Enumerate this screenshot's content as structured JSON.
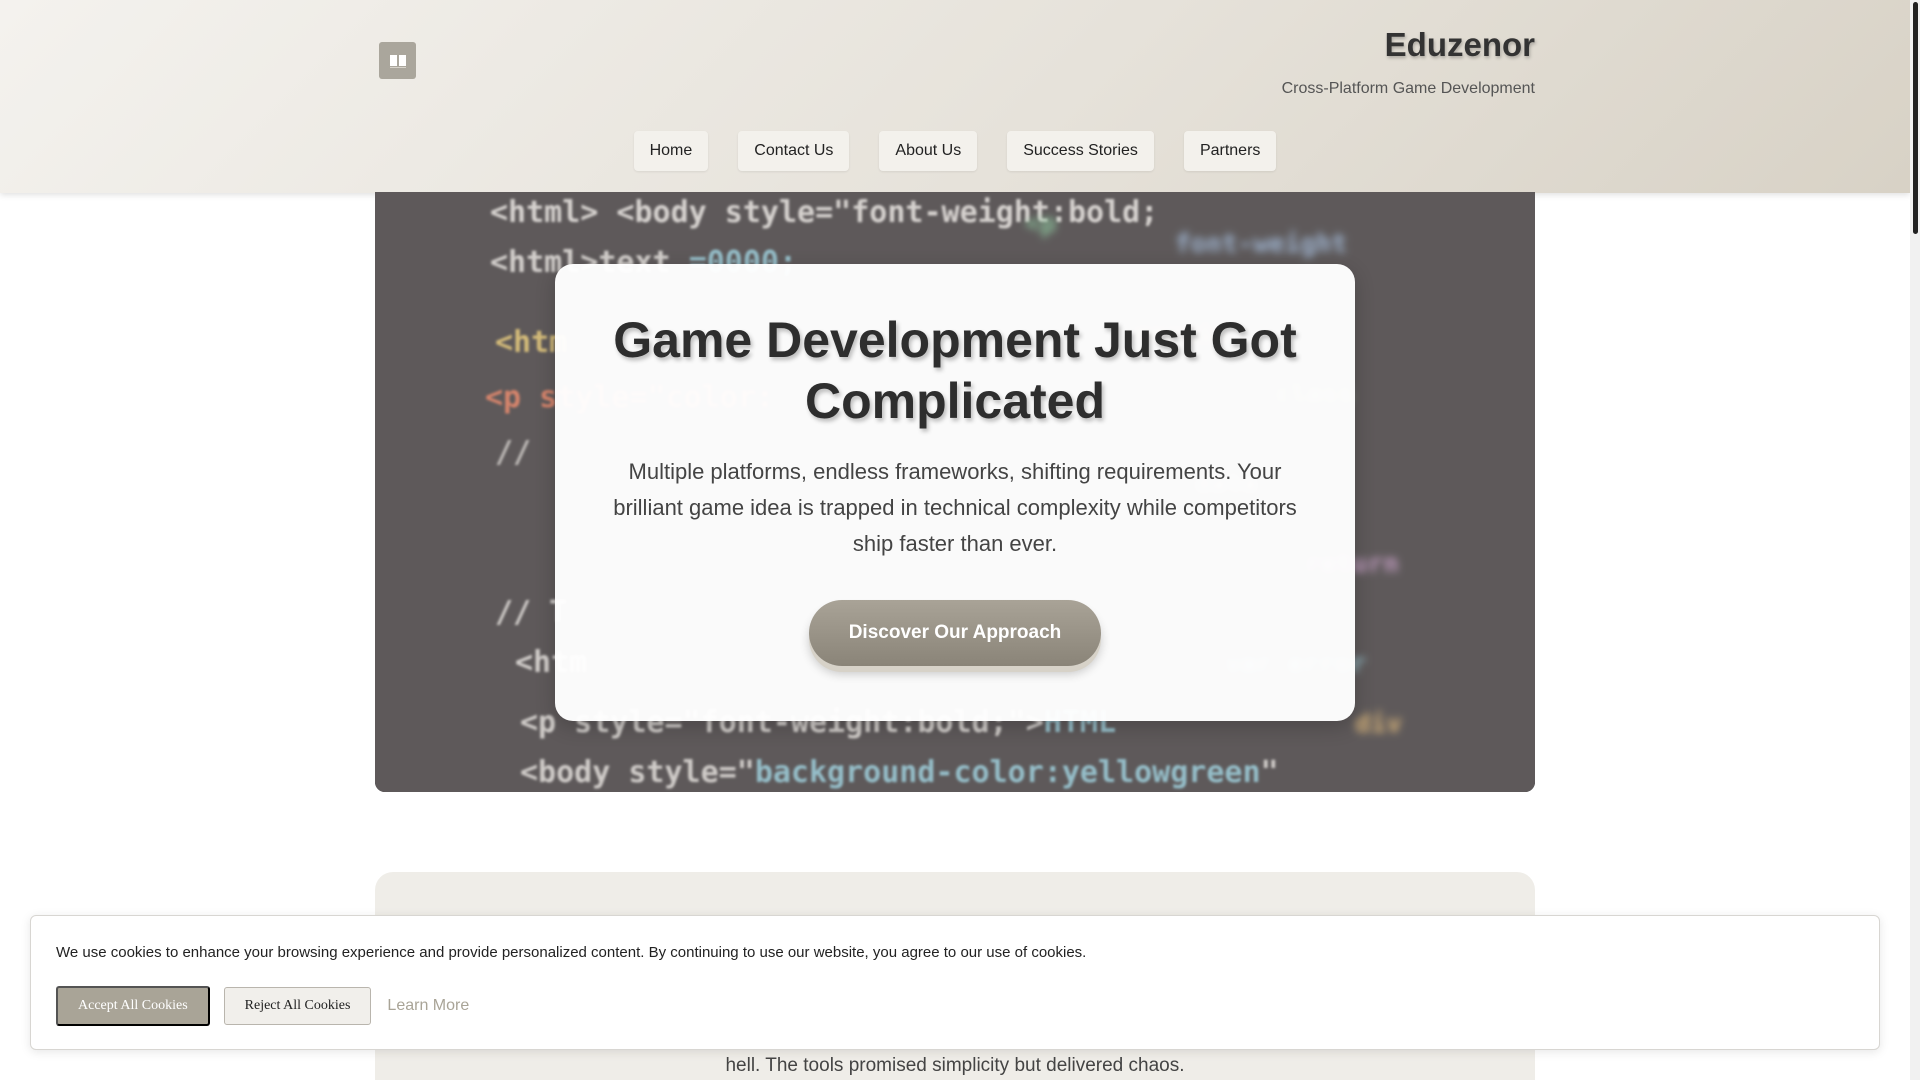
{
  "header": {
    "logo_icon": "book-icon",
    "brand_name": "Eduzenor",
    "tagline": "Cross-Platform Game Development"
  },
  "nav": {
    "items": [
      {
        "label": "Home"
      },
      {
        "label": "Contact Us"
      },
      {
        "label": "About Us"
      },
      {
        "label": "Success Stories"
      },
      {
        "label": "Partners"
      }
    ]
  },
  "hero": {
    "title": "Game Development Just Got Complicated",
    "text": "Multiple platforms, endless frameworks, shifting requirements. Your brilliant game idea is trapped in technical complexity while competitors ship faster than ever.",
    "cta_label": "Discover Our Approach",
    "background": "code-screen-image"
  },
  "section2": {
    "partial_text": "hell. The tools promised simplicity but delivered chaos."
  },
  "cookie": {
    "message": "We use cookies to enhance your browsing experience and provide personalized content. By continuing to use our website, you agree to our use of cookies.",
    "accept_label": "Accept All Cookies",
    "reject_label": "Reject All Cookies",
    "learn_more_label": "Learn More"
  },
  "colors": {
    "accent": "#a9a497",
    "header_bg": "#e6e2da",
    "section_bg": "#efede8"
  }
}
